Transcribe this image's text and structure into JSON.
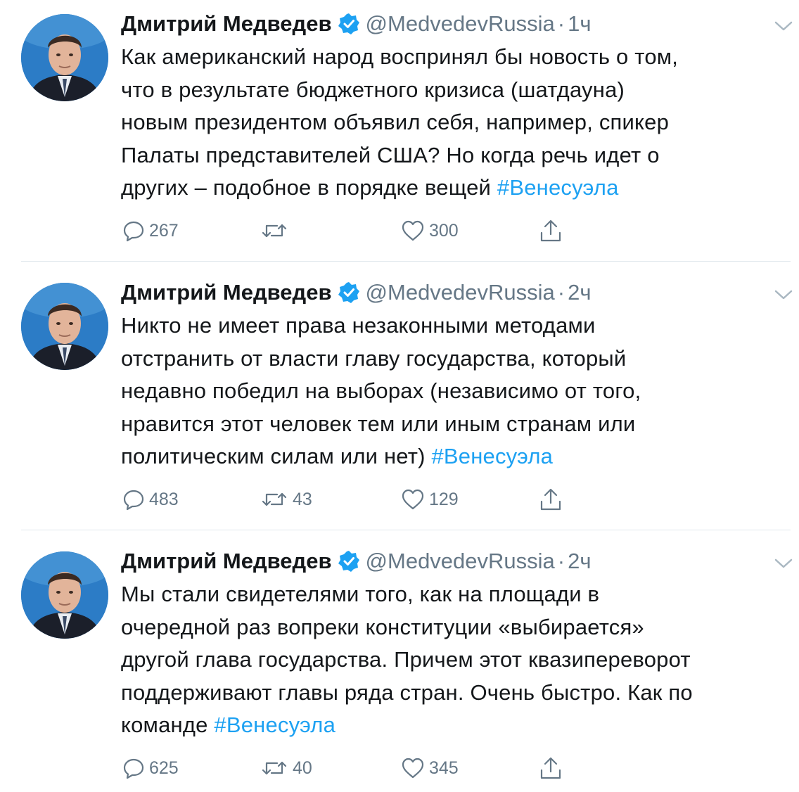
{
  "tweets": [
    {
      "author": "Дмитрий Медведев",
      "handle": "@MedvedevRussia",
      "separator": "·",
      "time": "1ч",
      "text_lines": [
        "Как американский народ воспринял бы новость о том,",
        "что в результате бюджетного кризиса (шатдауна)",
        "новым президентом объявил себя, например, спикер",
        "Палаты представителей США? Но когда речь идет о"
      ],
      "last_line_text": "других – подобное в порядке вещей",
      "hashtag": "#Венесуэла",
      "replies": "267",
      "retweets": "",
      "likes": "300"
    },
    {
      "author": "Дмитрий Медведев",
      "handle": "@MedvedevRussia",
      "separator": "·",
      "time": "2ч",
      "text_lines": [
        "Никто не имеет права незаконными методами",
        "отстранить от власти главу государства, который",
        "недавно победил на выборах (независимо от того,",
        "нравится этот человек тем или иным странам или"
      ],
      "last_line_text": "политическим силам или нет)",
      "hashtag": "#Венесуэла",
      "replies": "483",
      "retweets": "43",
      "likes": "129"
    },
    {
      "author": "Дмитрий Медведев",
      "handle": "@MedvedevRussia",
      "separator": "·",
      "time": "2ч",
      "text_lines": [
        "Мы стали свидетелями того, как на площади в",
        "очередной раз вопреки конституции «выбирается»",
        "другой глава государства. Причем этот квазипереворот",
        "поддерживают главы ряда стран. Очень быстро. Как по"
      ],
      "last_line_text": "команде",
      "hashtag": "#Венесуэла",
      "replies": "625",
      "retweets": "40",
      "likes": "345"
    }
  ],
  "icons": {
    "verified": "verified-badge-icon",
    "chevron": "chevron-down-icon",
    "reply": "reply-icon",
    "retweet": "retweet-icon",
    "like": "heart-icon",
    "share": "share-icon"
  },
  "colors": {
    "text": "#14171a",
    "secondary": "#657786",
    "accent": "#1da1f2",
    "divider": "#e1e8ed"
  }
}
